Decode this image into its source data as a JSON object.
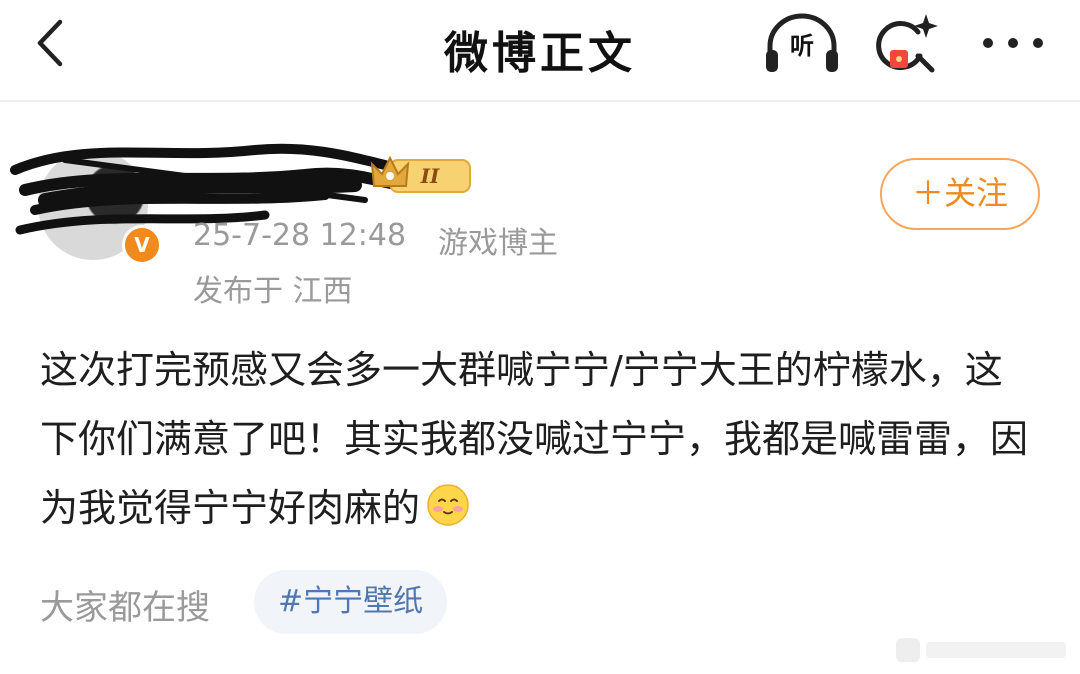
{
  "header": {
    "title": "微博正文",
    "listen_label": "听"
  },
  "post": {
    "follow_label": "＋关注",
    "timestamp": "25-7-28 12:48",
    "role": "游戏博主",
    "location": "发布于 江西",
    "verified_mark": "V",
    "rank_badge": "II",
    "text": "这次打完预感又会多一大群喊宁宁/宁宁大王的柠檬水，这下你们满意了吧！其实我都没喊过宁宁，我都是喊雷雷，因为我觉得宁宁好肉麻的",
    "emoji": "shy-smile-emoji"
  },
  "trending": {
    "label": "大家都在搜",
    "topic": "#宁宁壁纸"
  },
  "icons": {
    "back": "back-arrow-icon",
    "listen": "headphones-icon",
    "search": "search-sparkle-icon",
    "more": "more-dots-icon"
  },
  "colors": {
    "accent": "#f08a1c",
    "topic": "#4f78b2",
    "meta": "#9a9a9a"
  }
}
